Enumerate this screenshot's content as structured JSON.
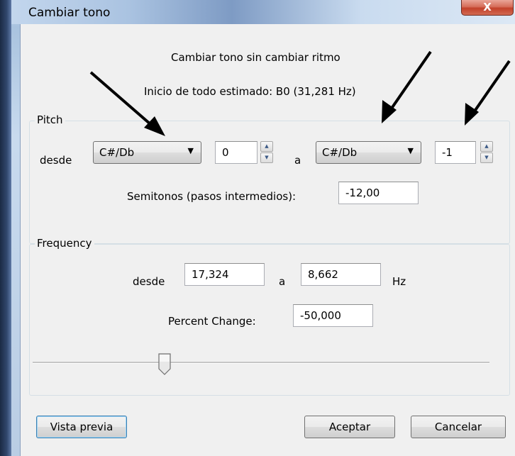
{
  "window": {
    "title": "Cambiar tono",
    "close_glyph": "X"
  },
  "header": {
    "line1": "Cambiar tono sin cambiar ritmo",
    "line2": "Inicio de todo estimado: B0 (31,281 Hz)"
  },
  "pitch": {
    "group_label": "Pitch",
    "from_label": "desde",
    "from_note": "C#/Db",
    "from_octave": "0",
    "to_label": "a",
    "to_note": "C#/Db",
    "to_octave": "-1",
    "semitones_label": "Semitonos (pasos intermedios):",
    "semitones_value": "-12,00"
  },
  "frequency": {
    "group_label": "Frequency",
    "from_label": "desde",
    "from_value": "17,324",
    "to_label": "a",
    "to_value": "8,662",
    "unit": "Hz",
    "percent_label": "Percent Change:",
    "percent_value": "-50,000",
    "slider_percent_change": -50
  },
  "buttons": {
    "preview": "Vista previa",
    "ok": "Aceptar",
    "cancel": "Cancelar"
  },
  "icons": {
    "dropdown_arrow": "▼",
    "spin_up": "▲",
    "spin_down": "▼"
  },
  "colors": {
    "dialog_bg": "#f0f0f0",
    "close_button": "#c2412a",
    "annotation_arrow": "#000000"
  }
}
